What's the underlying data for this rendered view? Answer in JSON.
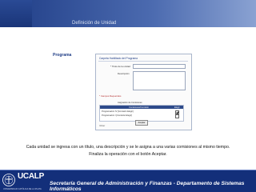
{
  "header": {
    "title": "Definición de Unidad"
  },
  "section": {
    "label": "Programa"
  },
  "window": {
    "title": "Carpeta Habilitado del Programa",
    "fields": [
      {
        "label": "* Título de la unidad",
        "value": ""
      },
      {
        "label": "Descripción",
        "value": ""
      }
    ],
    "required_note": "* Campos Requeridos",
    "group_title": "Asignación de Comisiones",
    "table": {
      "headers": [
        "Comisiones/Comisión",
        "Elegir"
      ],
      "rows": [
        {
          "name": "Programación IV [Comisión Elegir]",
          "checked": true
        },
        {
          "name": "Programación I [Comisión Elegir]",
          "checked": false
        }
      ]
    },
    "button_label": "Aceptar",
    "back_link": "Volver"
  },
  "captions": {
    "line1": "Cada unidad se ingresa con un título, una descripción y se le asigna a una varias comisiones al mismo tiempo.",
    "line2": "Finaliza la operación con el botón Aceptar."
  },
  "footer": {
    "logo": "UCALP",
    "logo_sub": "UNIVERSIDAD CATÓLICA DE LA PLATA",
    "text": "Secretaría General de Administración y Finanzas - Departamento de Sistemas Informáticos"
  },
  "colors": {
    "brand_dark": "#132f7a",
    "brand": "#1f3d86",
    "table_header": "#2d4a8a"
  }
}
